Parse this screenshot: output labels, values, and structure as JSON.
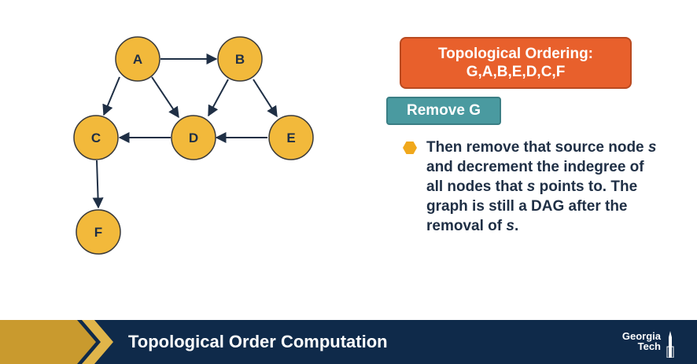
{
  "graph": {
    "nodes": {
      "A": "A",
      "B": "B",
      "C": "C",
      "D": "D",
      "E": "E",
      "F": "F"
    }
  },
  "ordering": {
    "title": "Topological Ordering:",
    "sequence": "G,A,B,E,D,C,F"
  },
  "step_label": "Remove G",
  "bullet": {
    "part1": "Then remove that source node ",
    "var1": "s",
    "part2": " and decrement the indegree of all nodes that ",
    "var2": "s",
    "part3": " points to. The graph is still a DAG after the removal of ",
    "var3": "s",
    "part4": "."
  },
  "footer": {
    "title": "Topological Order Computation",
    "logo_line1": "Georgia",
    "logo_line2": "Tech"
  },
  "colors": {
    "node_fill": "#f2b93b",
    "order_box": "#e8602c",
    "step_box": "#4a9aa0",
    "bullet": "#f0a81c",
    "footer_bg": "#0f2a4a",
    "chevron_gold": "#c99a2e"
  }
}
